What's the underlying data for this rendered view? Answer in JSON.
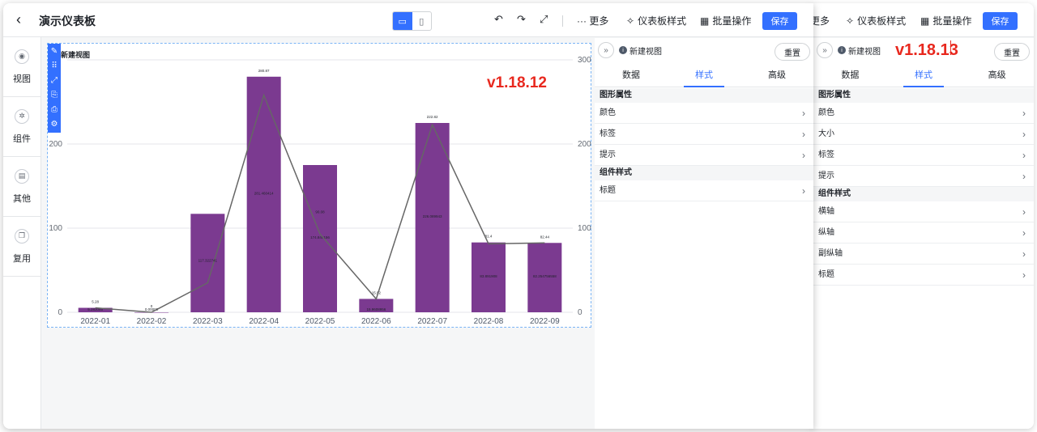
{
  "front": {
    "title": "演示仪表板",
    "toolbar": {
      "more": "··· 更多",
      "style": "仪表板样式",
      "batch": "批量操作",
      "save": "保存"
    },
    "nav": [
      {
        "label": "视图",
        "icon": "eye-icon"
      },
      {
        "label": "组件",
        "icon": "gear-icon"
      },
      {
        "label": "其他",
        "icon": "box-icon"
      },
      {
        "label": "复用",
        "icon": "copy-icon"
      }
    ],
    "chart_title": "新建视图",
    "version": "v1.18.12",
    "panel": {
      "name": "新建视图",
      "reset": "重置",
      "tabs": [
        "数据",
        "样式",
        "高级"
      ],
      "active_tab": "样式",
      "sections": [
        {
          "title": "图形属性",
          "rows": [
            "颜色",
            "标签",
            "提示"
          ]
        },
        {
          "title": "组件样式",
          "rows": [
            "标题"
          ]
        }
      ]
    }
  },
  "back": {
    "toolbar": {
      "more": "更多",
      "style": "仪表板样式",
      "batch": "批量操作",
      "save": "保存"
    },
    "version": "v1.18.13",
    "panel": {
      "name": "新建视图",
      "reset": "重置",
      "tabs": [
        "数据",
        "样式",
        "高级"
      ],
      "active_tab": "样式",
      "sections": [
        {
          "title": "图形属性",
          "rows": [
            "颜色",
            "大小",
            "标签",
            "提示"
          ]
        },
        {
          "title": "组件样式",
          "rows": [
            "横轴",
            "纵轴",
            "副纵轴",
            "标题"
          ]
        }
      ]
    }
  },
  "colors": {
    "accent": "#3370ff",
    "bar": "#7b3a90",
    "line": "#666666",
    "version": "#e8281e"
  },
  "chart_data": {
    "type": "bar",
    "categories": [
      "2022-01",
      "2022-02",
      "2022-03",
      "2022-04",
      "2022-05",
      "2022-06",
      "2022-07",
      "2022-08",
      "2022-09"
    ],
    "series": [
      {
        "type": "bar",
        "values": [
          5.28,
          0,
          117,
          280,
          175,
          15.9,
          225,
          83,
          82.44
        ],
        "labels": [
          "5.28",
          "0",
          "",
          "280.87",
          "",
          "15.92",
          "222.82",
          "81.4",
          "82.44"
        ],
        "inner_labels": [
          "5.283085",
          "0.00000",
          "",
          "281.460414",
          "174.840156",
          "15.9608956",
          "226.089943",
          "83.891908",
          "82.254756558"
        ]
      },
      {
        "type": "line",
        "axis": "right",
        "values": [
          5.28,
          0,
          35,
          258,
          93,
          15.9,
          222.82,
          81.4,
          82.44
        ],
        "labels": [
          "",
          "",
          "117.322741",
          "",
          "90.08",
          "",
          "",
          "",
          ""
        ]
      }
    ],
    "left_ticks": [
      "0",
      "100",
      "200"
    ],
    "right_ticks": [
      "0",
      "100",
      "200",
      "300"
    ],
    "ylim": [
      0,
      300
    ]
  }
}
